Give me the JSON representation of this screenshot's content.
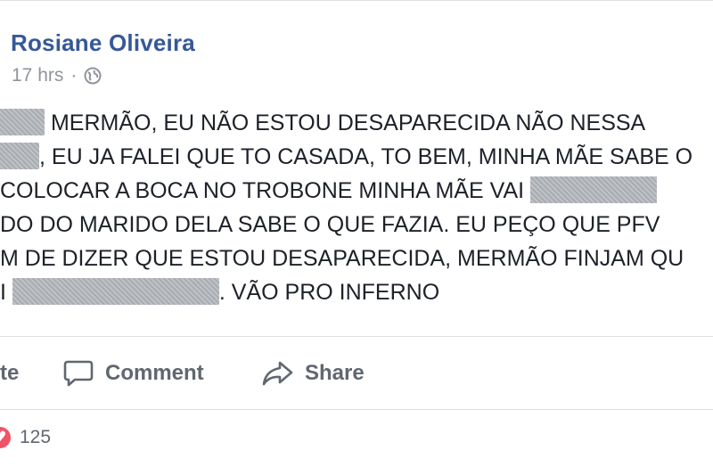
{
  "post": {
    "author": "Rosiane Oliveira",
    "time": "17 hrs",
    "separator": "·",
    "privacy_icon": "globe-icon",
    "lines": [
      {
        "before": "",
        "after": " MERMÃO, EU NÃO ESTOU DESAPARECIDA NÃO NESSA"
      },
      {
        "before": "",
        "after": ", EU JA FALEI QUE TO CASADA, TO BEM, MINHA MÃE SABE O"
      },
      {
        "before": " COLOCAR A BOCA NO TROBONE MINHA MÃE VAI ",
        "after": ""
      },
      {
        "before": "DO DO MARIDO DELA SABE O QUE FAZIA. EU PEÇO QUE PFV",
        "after": ""
      },
      {
        "before": "M DE DIZER QUE ESTOU DESAPARECIDA, MERMÃO FINJAM QU",
        "after": ""
      },
      {
        "before": "I ",
        "after": ". VÃO PRO INFERNO"
      }
    ]
  },
  "actions": {
    "like_label": "te",
    "comment_label": "Comment",
    "share_label": "Share"
  },
  "reactions": {
    "icon": "heart-icon",
    "count": "125"
  },
  "colors": {
    "author": "#365899",
    "meta": "#90949c",
    "text": "#1d2129",
    "action": "#606770",
    "love": "#f25268"
  }
}
